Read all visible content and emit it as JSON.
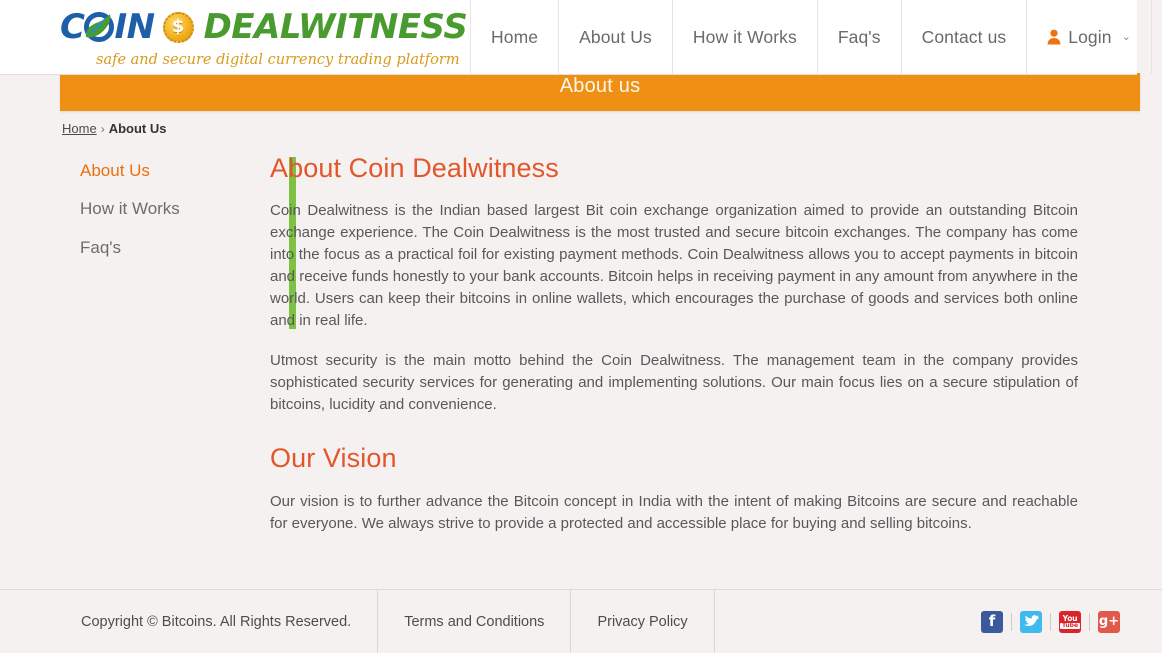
{
  "brand": {
    "coin_word": "COIN",
    "dealwitness_word": "DEALWITNESS",
    "coin_symbol": "$",
    "tagline": "safe and secure digital currency trading platform"
  },
  "nav": {
    "items": [
      {
        "label": "Home"
      },
      {
        "label": "About Us"
      },
      {
        "label": "How it Works"
      },
      {
        "label": "Faq's"
      },
      {
        "label": "Contact us"
      }
    ],
    "login_label": "Login",
    "caret": "⌄"
  },
  "banner": {
    "title": "About us"
  },
  "breadcrumb": {
    "home": "Home",
    "separator": "›",
    "current": "About Us"
  },
  "sidebar": {
    "items": [
      {
        "label": "About Us",
        "active": true
      },
      {
        "label": "How it Works",
        "active": false
      },
      {
        "label": "Faq's",
        "active": false
      }
    ]
  },
  "main": {
    "about_title": "About Coin Dealwitness",
    "about_para_1": "Coin Dealwitness is the Indian based largest Bit coin exchange organization aimed to provide an outstanding Bitcoin exchange experience. The Coin Dealwitness is the most trusted and secure bitcoin exchanges. The company has come into the focus as a practical foil for existing payment methods. Coin Dealwitness allows you to accept payments in bitcoin and receive funds honestly to your bank accounts. Bitcoin helps in receiving payment in any amount from anywhere in the world. Users can keep their bitcoins in online wallets, which encourages the purchase of goods and services both online and in real life.",
    "about_para_2": "Utmost security is the main motto behind the Coin Dealwitness. The management team in the company provides sophisticated security services for generating and implementing solutions. Our main focus lies on a secure stipulation of bitcoins, lucidity and convenience.",
    "vision_title": "Our Vision",
    "vision_para": "Our vision is to further advance the Bitcoin concept in India with the intent of making Bitcoins are secure and reachable for everyone. We always strive to provide a protected and accessible place for buying and selling bitcoins."
  },
  "footer": {
    "copyright": "Copyright © Bitcoins. All Rights Reserved.",
    "terms": "Terms and Conditions",
    "privacy": "Privacy Policy",
    "socials": [
      {
        "name": "facebook",
        "glyph": "f",
        "color": "#3b5a9b"
      },
      {
        "name": "twitter",
        "glyph": "➤",
        "color": "#3fbaf0"
      },
      {
        "name": "youtube",
        "glyph": "You",
        "sub": "Tube",
        "color": "#d9242a"
      },
      {
        "name": "google-plus",
        "glyph": "g+",
        "color": "#e0594b"
      }
    ]
  },
  "colors": {
    "orange": "#ef9014",
    "heading_orange": "#e2562a",
    "green": "#7dc242",
    "logo_blue": "#1f5fa8",
    "logo_green": "#4a9b2f",
    "page_bg": "#f6f1f1"
  }
}
